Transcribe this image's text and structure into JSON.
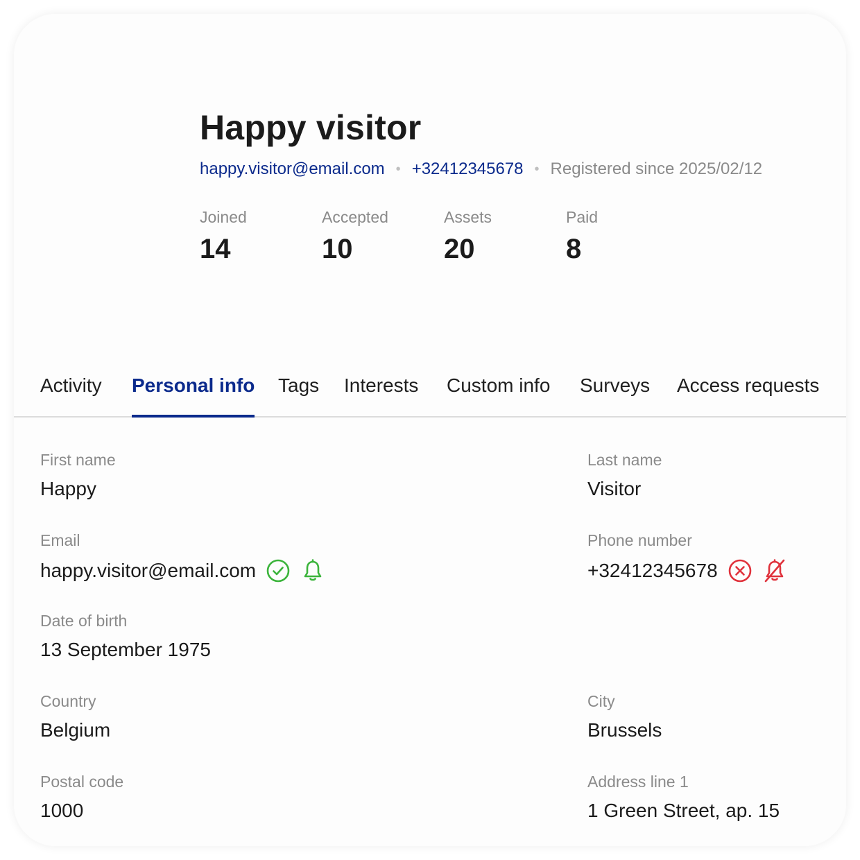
{
  "profile": {
    "name": "Happy visitor",
    "email": "happy.visitor@email.com",
    "phone": "+32412345678",
    "registered": "Registered since 2025/02/12",
    "separator": "•"
  },
  "stats": [
    {
      "label": "Joined",
      "value": "14"
    },
    {
      "label": "Accepted",
      "value": "10"
    },
    {
      "label": "Assets",
      "value": "20"
    },
    {
      "label": "Paid",
      "value": "8"
    }
  ],
  "tabs": [
    {
      "label": "Activity"
    },
    {
      "label": "Personal info",
      "active": true
    },
    {
      "label": "Tags"
    },
    {
      "label": "Interests"
    },
    {
      "label": "Custom info"
    },
    {
      "label": "Surveys"
    },
    {
      "label": "Access requests"
    }
  ],
  "fields": {
    "first_name": {
      "label": "First name",
      "value": "Happy"
    },
    "last_name": {
      "label": "Last name",
      "value": "Visitor"
    },
    "email": {
      "label": "Email",
      "value": "happy.visitor@email.com",
      "icons": [
        "verified-check-icon",
        "notification-bell-icon"
      ]
    },
    "phone": {
      "label": "Phone number",
      "value": "+32412345678",
      "icons": [
        "not-verified-x-icon",
        "notification-off-bell-icon"
      ]
    },
    "dob": {
      "label": "Date of birth",
      "value": "13 September 1975"
    },
    "country": {
      "label": "Country",
      "value": "Belgium"
    },
    "city": {
      "label": "City",
      "value": "Brussels"
    },
    "postal": {
      "label": "Postal code",
      "value": "1000"
    },
    "address1": {
      "label": "Address line 1",
      "value": "1 Green Street, ap. 15"
    }
  },
  "colors": {
    "accent": "#0b2a8c",
    "success": "#3cb43c",
    "error": "#e0323c",
    "muted": "#8a8a8a"
  }
}
